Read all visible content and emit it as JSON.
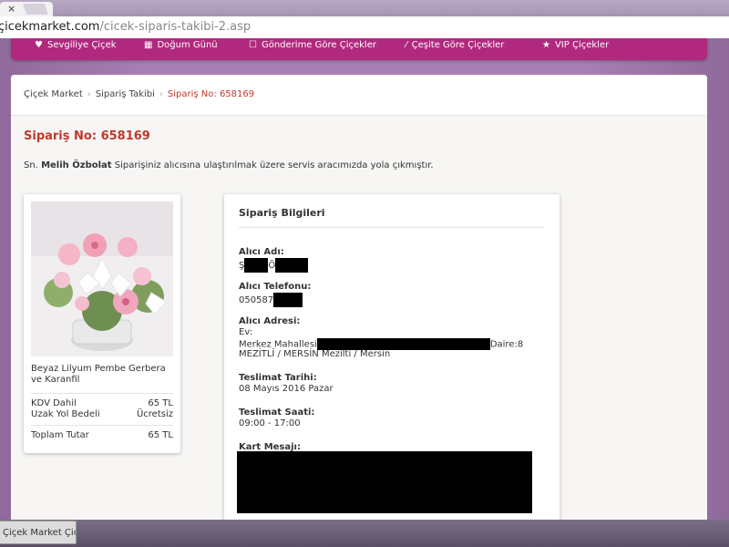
{
  "browser": {
    "tab_close": "×",
    "url_domain": "çicekmarket.com",
    "url_path": "/cicek-siparis-takibi-2.asp"
  },
  "nav": {
    "items": [
      {
        "label": "Sevgiliye Çiçek",
        "icon": "heart-icon"
      },
      {
        "label": "Doğum Günü",
        "icon": "cake-icon"
      },
      {
        "label": "Gönderime Göre Çiçekler",
        "icon": "checkbox-icon"
      },
      {
        "label": "Çeşite Göre Çiçekler",
        "icon": "wand-icon"
      },
      {
        "label": "VIP Çiçekler",
        "icon": "star-icon"
      }
    ]
  },
  "breadcrumb": {
    "home": "Çiçek Market",
    "section": "Sipariş Takibi",
    "current": "Sipariş No: 658169"
  },
  "order": {
    "title": "Sipariş No: 658169",
    "salutation": "Sn.",
    "customer": "Melih Özbolat",
    "status_text": "Siparişiniz alıcısına ulaştırılmak üzere servis aracımızda yola çıkmıştır."
  },
  "product": {
    "name": "Beyaz Lilyum Pembe Gerbera ve Karanfil",
    "rows": [
      {
        "label": "KDV Dahil",
        "value": "65 TL"
      },
      {
        "label": "Uzak Yol Bedeli",
        "value": "Ücretsiz"
      }
    ],
    "total_label": "Toplam Tutar",
    "total_value": "65 TL"
  },
  "info": {
    "title": "Sipariş Bilgileri",
    "recipient_name_label": "Alıcı Adı:",
    "recipient_name_a": "Ş",
    "recipient_name_b": "Ö",
    "phone_label": "Alıcı Telefonu:",
    "phone_prefix": "050587",
    "address_label": "Alıcı Adresi:",
    "address_line1": "Ev:",
    "address_line2a": "Merkez Mahallesi",
    "address_line2b": "Daire:8",
    "address_line3": "MEZİTLİ / MERSİN Mezilti / Mersin",
    "date_label": "Teslimat Tarihi:",
    "date_value": "08 Mayıs 2016 Pazar",
    "time_label": "Teslimat Saati:",
    "time_value": "09:00 - 17:00",
    "card_label": "Kart Mesajı:"
  },
  "taskbar": {
    "item": "Çiçek Market Çiçe..."
  },
  "colors": {
    "brand": "#b0297e",
    "accent_red": "#c0392b"
  }
}
